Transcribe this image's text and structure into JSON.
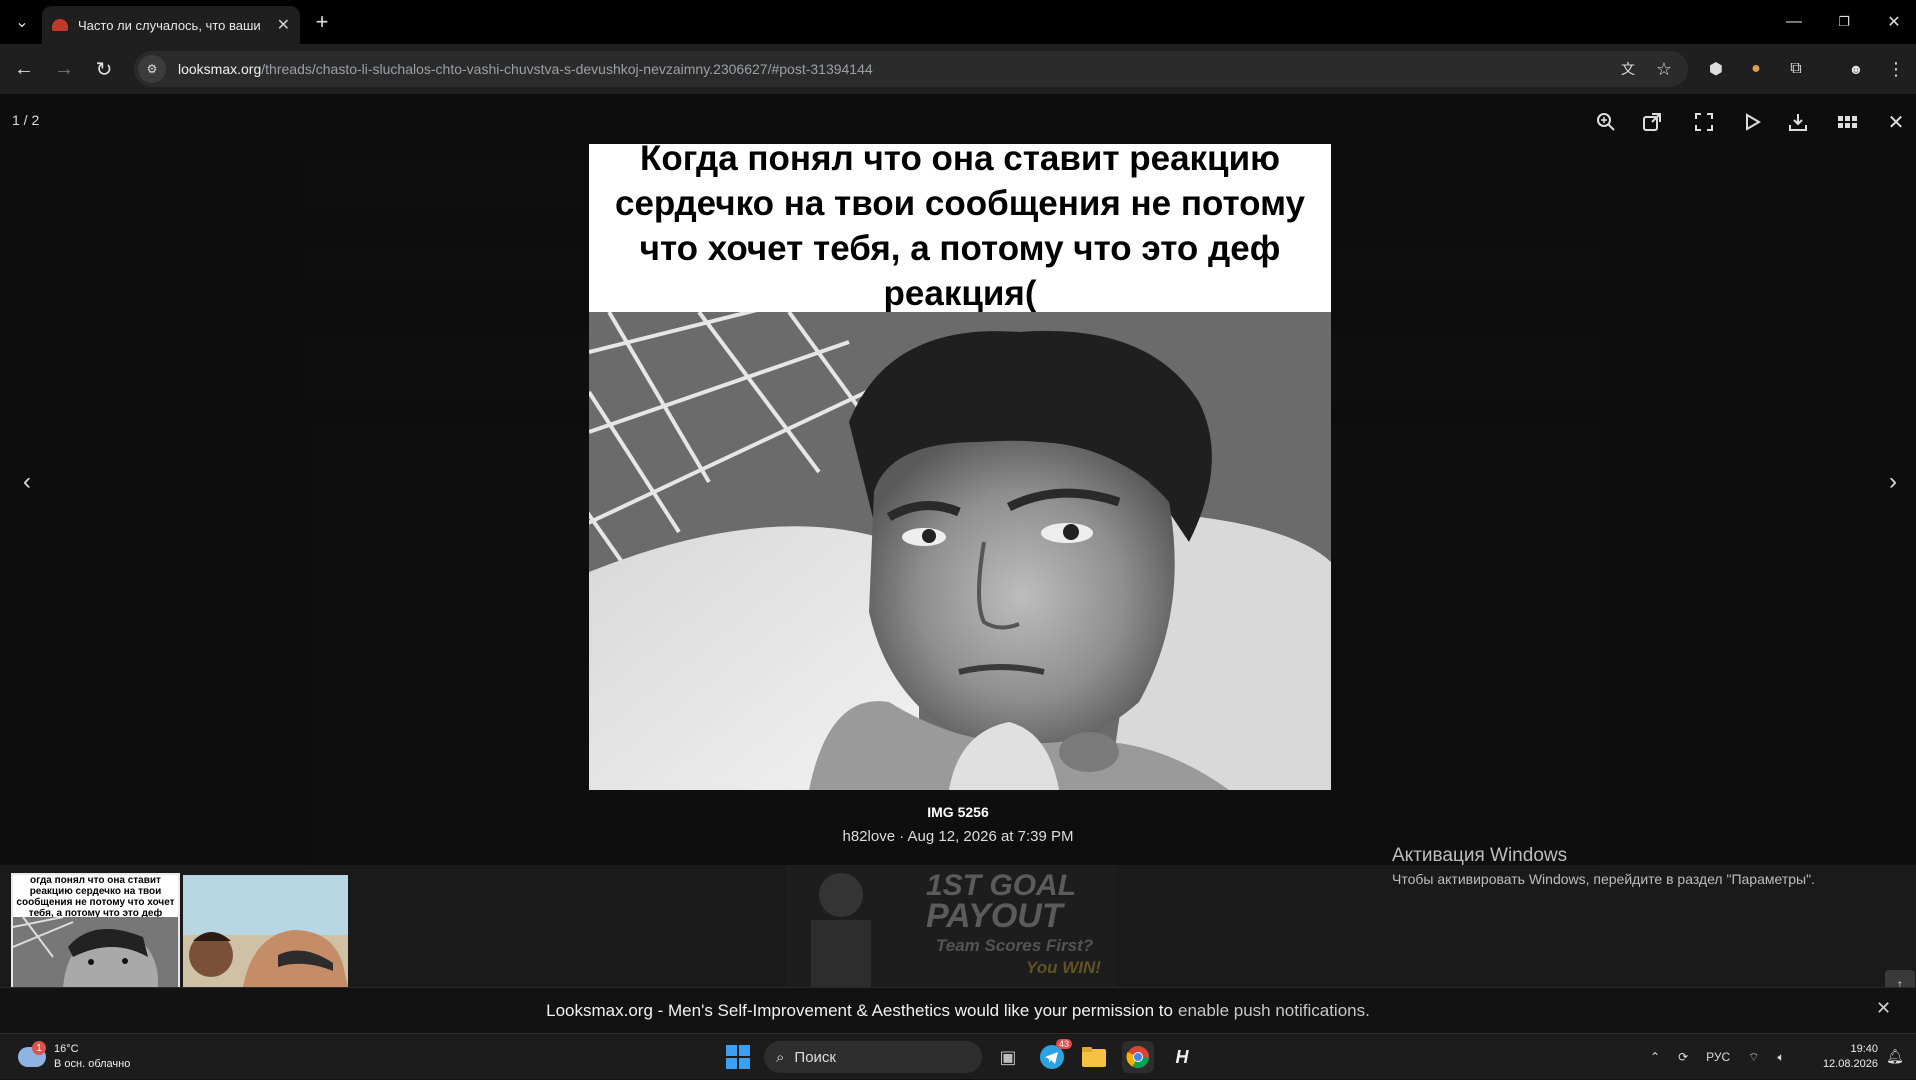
{
  "browser": {
    "tab_title": "Часто ли случалось, что ваши",
    "new_tab": "+",
    "url_host": "looksmax.org",
    "url_path": "/threads/chasto-li-sluchalos-chto-vashi-chuvstva-s-devushkoj-nevzaimny.2306627/#post-31394144"
  },
  "lightbox": {
    "counter": "1 / 2",
    "caption": "Когда понял что она ставит реакцию сердечко на твои сообщения не потому что хочет тебя, а потому что это деф реакция(",
    "image_title": "IMG 5256",
    "image_meta": "h82love · Aug 12, 2026 at 7:39 PM",
    "thumb_caption": "огда понял что она ставит реакцию сердечко на твои сообщения не потому что хочет тебя, а потому что это деф реакция("
  },
  "ad": {
    "line1": "1ST GOAL",
    "line2": "PAYOUT",
    "line3": "Team Scores First?",
    "line4": "You WIN!"
  },
  "windows_activation": {
    "heading": "Активация Windows",
    "sub": "Чтобы активировать Windows, перейдите в раздел \"Параметры\"."
  },
  "push": {
    "text": "Looksmax.org - Men's Self-Improvement & Aesthetics would like your permission to",
    "link": "enable push notifications."
  },
  "taskbar": {
    "weather_badge": "1",
    "temp": "16°C",
    "weather_desc": "В осн. облачно",
    "search_placeholder": "Поиск",
    "telegram_badge": "43",
    "lang": "РУС",
    "time": "19:40",
    "date": "12.08.2026"
  }
}
